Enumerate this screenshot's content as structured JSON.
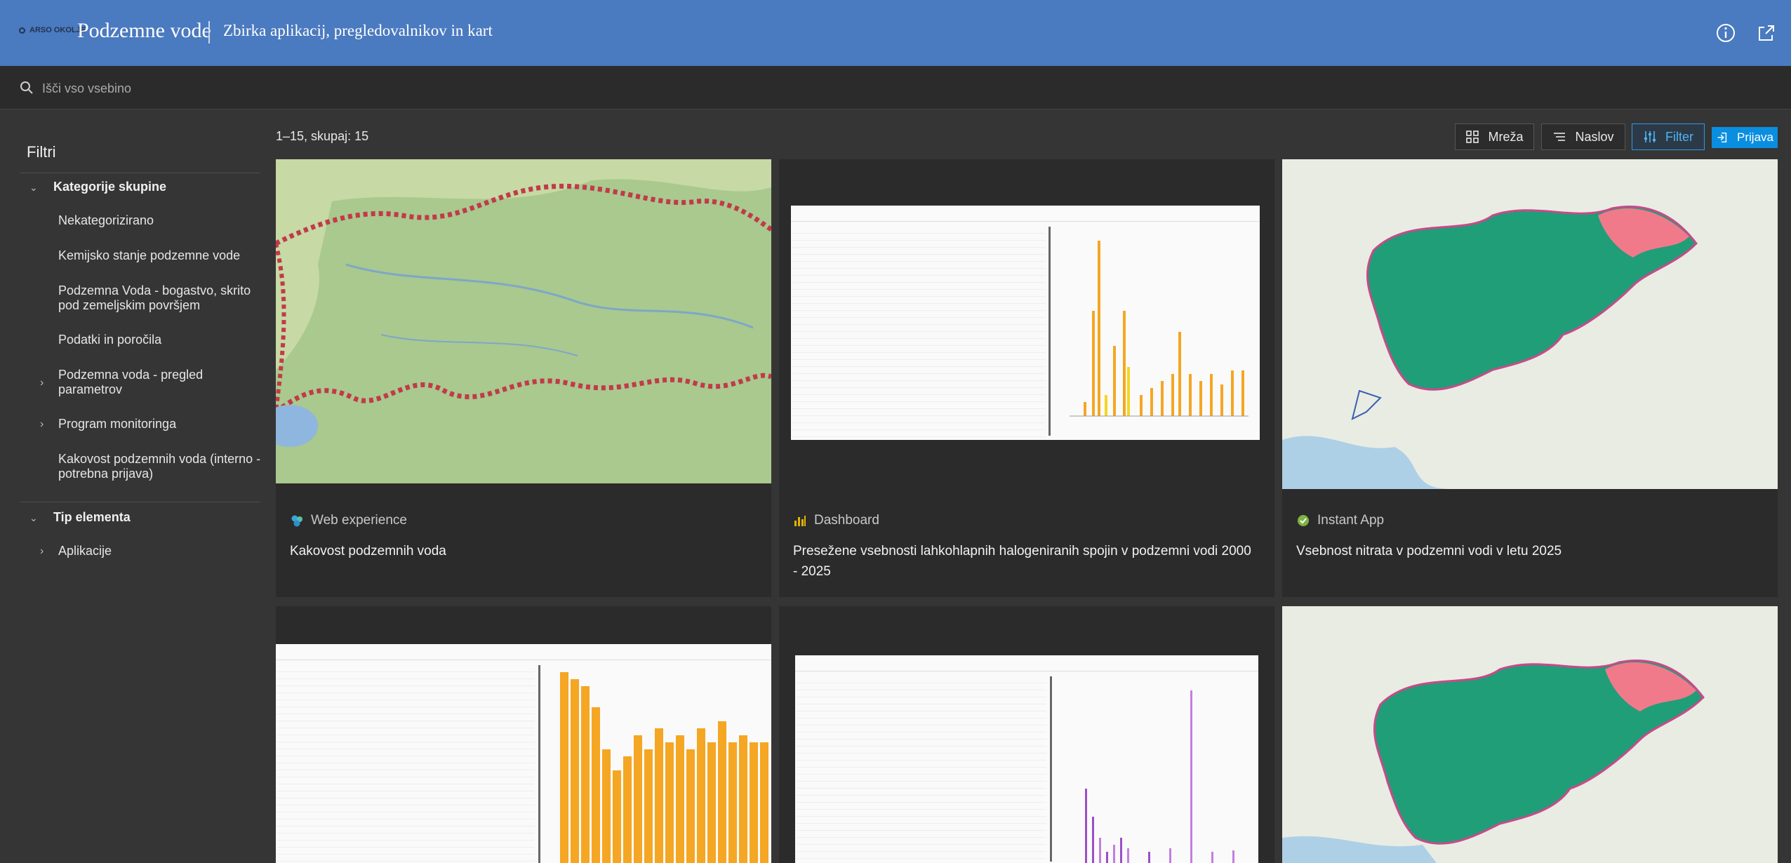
{
  "header": {
    "logo_text": "ARSO OKOLJE",
    "title": "Podzemne vode",
    "subtitle": "Zbirka aplikacij, pregledovalnikov in kart",
    "info_icon": "info-icon",
    "share_icon": "share-icon"
  },
  "search": {
    "placeholder": "Išči vso vsebino",
    "value": ""
  },
  "sidebar": {
    "title": "Filtri",
    "groups": [
      {
        "label": "Kategorije skupine",
        "expanded": true,
        "items": [
          {
            "label": "Nekategorizirano",
            "has_children": false
          },
          {
            "label": "Kemijsko stanje podzemne vode",
            "has_children": false
          },
          {
            "label": "Podzemna Voda - bogastvo, skrito pod zemeljskim površjem",
            "has_children": false
          },
          {
            "label": "Podatki in poročila",
            "has_children": false
          },
          {
            "label": "Podzemna voda - pregled parametrov",
            "has_children": true
          },
          {
            "label": "Program monitoringa",
            "has_children": true
          },
          {
            "label": "Kakovost podzemnih voda (interno - potrebna prijava)",
            "has_children": false
          }
        ]
      },
      {
        "label": "Tip elementa",
        "expanded": true,
        "items": [
          {
            "label": "Aplikacije",
            "has_children": true
          }
        ]
      }
    ]
  },
  "toolbar": {
    "results": "1–15, skupaj: 15",
    "grid_label": "Mreža",
    "sort_label": "Naslov",
    "filter_label": "Filter",
    "signin_label": "Prijava"
  },
  "colors": {
    "header": "#4a7abf",
    "accent": "#0a8ee0",
    "map_green": "#1f9e78",
    "map_pink": "#f07a8a",
    "bar_orange": "#f5a623",
    "bar_purple": "#9b4fc9"
  },
  "cards": [
    {
      "type": "Web experience",
      "type_icon": "web-experience-icon",
      "title": "Kakovost podzemnih voda"
    },
    {
      "type": "Dashboard",
      "type_icon": "dashboard-icon",
      "title": "Presežene vsebnosti lahkohlapnih halogeniranih spojin v podzemni vodi 2000 - 2025"
    },
    {
      "type": "Instant App",
      "type_icon": "instant-app-icon",
      "title": "Vsebnost nitrata v podzemni vodi v letu 2025"
    },
    {
      "type": "",
      "type_icon": "",
      "title": ""
    },
    {
      "type": "",
      "type_icon": "",
      "title": ""
    },
    {
      "type": "",
      "type_icon": "",
      "title": ""
    }
  ]
}
